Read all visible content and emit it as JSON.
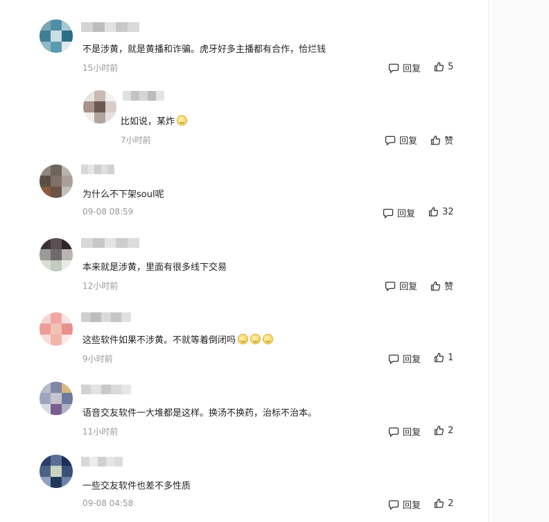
{
  "comments": [
    {
      "text": "不是涉黄，就是黄播和诈骗。虎牙好多主播都有合作，恰烂钱",
      "time": "15小时前",
      "reply": "回复",
      "likes": "5",
      "emojis": 0,
      "avatar": [
        "#7aa6b8",
        "#4f8fa8",
        "#a8c7d3",
        "#3f7f94",
        "#c9dde4",
        "#2a6e86",
        "#8fb9c8",
        "#5b9bb0",
        "#dfe9ed"
      ],
      "name": [
        "#d4d4d4",
        "#bdbdbd",
        "#e2e2e2",
        "#c8c8c8",
        "#d9d9d9"
      ]
    },
    {
      "text": "比如说，某炸",
      "time": "7小时前",
      "reply": "回复",
      "likes": "赞",
      "emojis": 1,
      "avatar": [
        "#e9e4e2",
        "#c9b9b2",
        "#f3f0ef",
        "#a8928a",
        "#6d5953",
        "#d8cdc9",
        "#f1eeec",
        "#b4a49e",
        "#e6e1df"
      ],
      "name": [
        "#e0e0e0",
        "#c4c4c4",
        "#d6d6d6",
        "#bcbcbc",
        "#e4e4e4"
      ]
    },
    {
      "text": "为什么不下架soul呢",
      "time": "09-08 08:59",
      "reply": "回复",
      "likes": "32",
      "emojis": 0,
      "avatar": [
        "#8f8780",
        "#6e645c",
        "#b9b2ac",
        "#5a4f47",
        "#7f7167",
        "#a99f98",
        "#8d5a3c",
        "#6a5447",
        "#c6bfb9"
      ],
      "name": [
        "#d8d8d8",
        "#e6e6e6",
        "#cfcfcf",
        "#e0e0e0",
        "#d2d2d2"
      ]
    },
    {
      "text": "本来就是涉黄，里面有很多线下交易",
      "time": "12小时前",
      "reply": "回复",
      "likes": "赞",
      "emojis": 0,
      "avatar": [
        "#3b3236",
        "#5b4f54",
        "#2d2629",
        "#9a9a98",
        "#6f6b6c",
        "#b8b5b3",
        "#d7dfd3",
        "#c1cbc0",
        "#e8ece6"
      ],
      "name": [
        "#d9d9d9",
        "#c7c7c7",
        "#e3e3e3",
        "#cdcdcd",
        "#dcdcdc"
      ]
    },
    {
      "text": "这些软件如果不涉黄。不就等着倒闭吗",
      "time": "9小时前",
      "reply": "回复",
      "likes": "1",
      "emojis": 3,
      "avatar": [
        "#f6d3d0",
        "#f0a8a4",
        "#f9e2df",
        "#ee9d98",
        "#f3c2b4",
        "#e98f8a",
        "#f8dcd8",
        "#f2b3ad",
        "#fbe9e7"
      ],
      "name": [
        "#cfcfcf",
        "#bdbdbd",
        "#dadada",
        "#c6c6c6",
        "#e0e0e0"
      ]
    },
    {
      "text": "语音交友软件一大堆都是这样。换汤不换药，治标不治本。",
      "time": "11小时前",
      "reply": "回复",
      "likes": "2",
      "emojis": 0,
      "avatar": [
        "#b9bcc9",
        "#7f86a6",
        "#d9b77f",
        "#9ea4be",
        "#c8c2cf",
        "#6f7aa0",
        "#d8dbe5",
        "#7a5f8e",
        "#aeb3c9"
      ],
      "name": [
        "#d2d2d2",
        "#e3e3e3",
        "#c9c9c9",
        "#dadada",
        "#e6e6e6"
      ]
    },
    {
      "text": "一些交友软件也差不多性质",
      "time": "09-08 04:58",
      "reply": "回复",
      "likes": "2",
      "emojis": 0,
      "avatar": [
        "#2d3e66",
        "#5a6e94",
        "#1f2f55",
        "#4b6386",
        "#c9d3c0",
        "#3a5077",
        "#8fa2bf",
        "#23375e",
        "#6f83a6"
      ],
      "name": [
        "#d8d8d8",
        "#ececec",
        "#d0d0d0",
        "#e4e4e4",
        "#dcdcdc"
      ]
    }
  ],
  "icons": {
    "reply": "comment-bubble-icon",
    "like": "thumbs-up-icon",
    "emoji": "smiley-emoji-icon"
  }
}
